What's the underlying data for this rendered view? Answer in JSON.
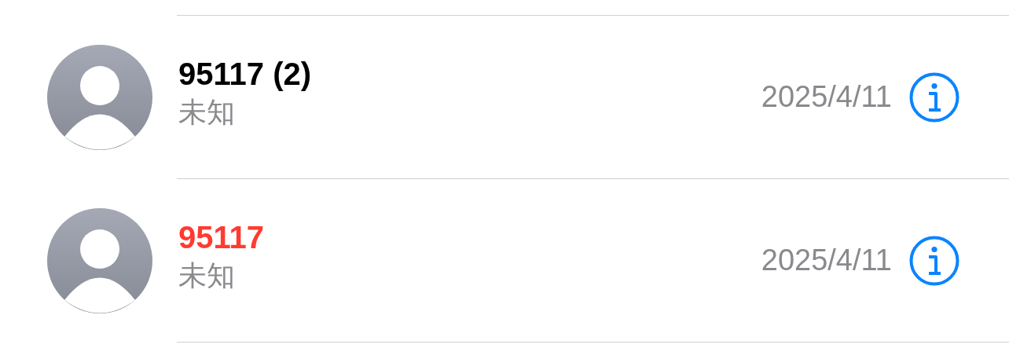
{
  "calls": [
    {
      "name": "95117 (2)",
      "missed": false,
      "label": "未知",
      "date": "2025/4/11"
    },
    {
      "name": "95117",
      "missed": true,
      "label": "未知",
      "date": "2025/4/11"
    }
  ]
}
